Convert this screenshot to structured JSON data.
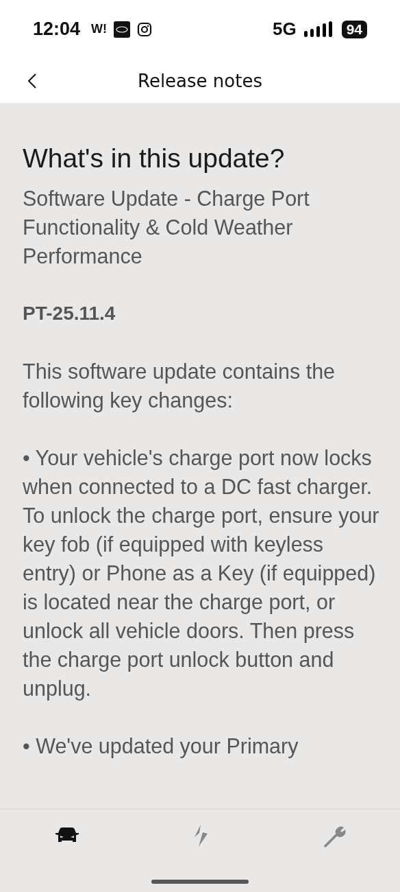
{
  "status_bar": {
    "time": "12:04",
    "app_badge": "W!",
    "network": "5G",
    "battery": "94"
  },
  "header": {
    "title": "Release notes"
  },
  "content": {
    "heading": "What's in this update?",
    "subtitle": "Software Update - Charge Port Functionality & Cold Weather Performance",
    "version": "PT-25.11.4",
    "paragraphs": [
      "This software update contains the following key changes:",
      "• Your vehicle's charge port now locks when connected to a DC fast charger. To unlock the charge port, ensure your key fob (if equipped with keyless entry) or Phone as a Key (if equipped) is located near the charge port, or unlock all vehicle doors. Then press the charge port unlock button and unplug.",
      "• We've updated your Primary"
    ]
  },
  "nav": [
    {
      "kind": "vehicle",
      "selected": true
    },
    {
      "kind": "charging",
      "selected": false
    },
    {
      "kind": "service",
      "selected": false
    }
  ]
}
